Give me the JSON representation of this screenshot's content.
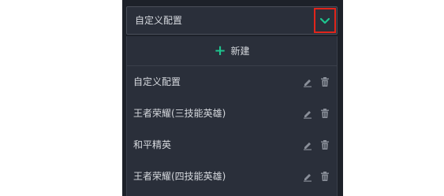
{
  "dropdown": {
    "selected": "自定义配置",
    "toggle_icon": "chevron-down-icon",
    "toggle_color": "#1ec48e",
    "highlight_color": "#e1251b"
  },
  "menu": {
    "new_label": "新建",
    "new_icon": "plus-icon",
    "items": [
      {
        "label": "自定义配置"
      },
      {
        "label": "王者荣耀(三技能英雄)"
      },
      {
        "label": "和平精英"
      },
      {
        "label": "王者荣耀(四技能英雄)"
      }
    ],
    "edit_icon": "pencil-icon",
    "delete_icon": "trash-icon"
  }
}
